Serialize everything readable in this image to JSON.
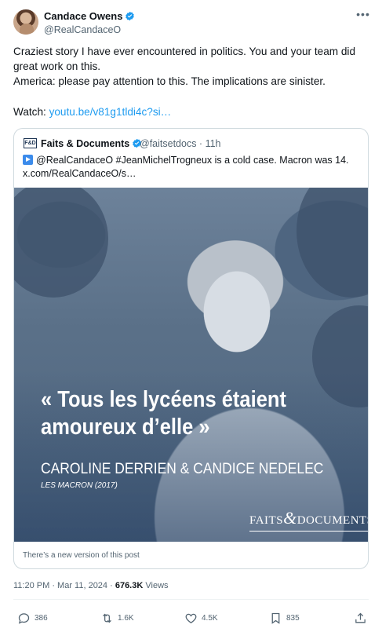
{
  "author": {
    "name": "Candace Owens",
    "handle": "@RealCandaceO"
  },
  "more_icon": "more-dots-icon",
  "tweet": {
    "text_line1": "Craziest story I have ever encountered in politics. You and your team did great work on this.",
    "text_line2": "America: please pay attention to this. The implications are sinister.",
    "watch_label": "Watch:",
    "link": "youtu.be/v81g1tldi4c?si…"
  },
  "quote": {
    "logo_text": "F&D",
    "name": "Faits & Documents",
    "handle": "@faitsetdocs",
    "time": "11h",
    "text_line1": "@RealCandaceO #JeanMichelTrogneux is a cold case. Macron was 14.",
    "text_line2": "x.com/RealCandaceO/s…",
    "image": {
      "quote_line1": "« Tous les lycéens étaient",
      "quote_line2": "amoureux d’elle »",
      "authors": "CAROLINE DERRIEN & CANDICE NEDELEC",
      "source": "LES MACRON (2017)",
      "brand_left": "FAITS",
      "brand_amp": "&",
      "brand_right": "DOCUMENTS"
    },
    "new_version_note": "There’s a new version of this post"
  },
  "meta": {
    "time": "11:20 PM · Mar 11, 2024 · ",
    "views_count": "676.3K",
    "views_label": " Views"
  },
  "actions": {
    "replies": "386",
    "reposts": "1.6K",
    "likes": "4.5K",
    "bookmarks": "835"
  },
  "colors": {
    "link": "#1d9bf0",
    "secondary_text": "#536471",
    "border": "#cfd9de"
  }
}
